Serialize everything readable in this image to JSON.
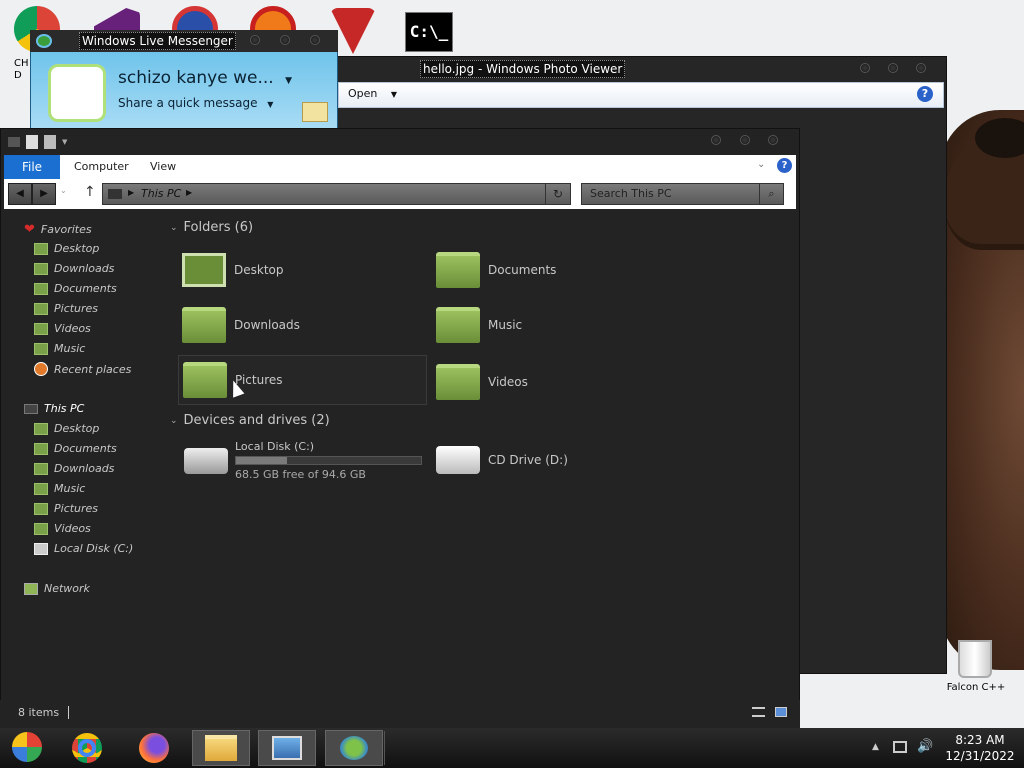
{
  "desktop": {
    "icons": [
      "chrome-icon",
      "visual-studio-icon",
      "origin-icon",
      "pdf-icon",
      "brand-icon",
      "cmd-icon"
    ],
    "cmd_label": "C:\\_",
    "partial_label": "CH\nD",
    "recycle_bin_label": "Falcon C++"
  },
  "photo_viewer": {
    "title": "hello.jpg - Windows Photo Viewer",
    "open_label": "Open",
    "help": "?"
  },
  "messenger": {
    "title": "Windows Live Messenger",
    "name": "schizo kanye we...",
    "message_placeholder": "Share a quick message"
  },
  "explorer": {
    "ribbon": {
      "file": "File",
      "computer": "Computer",
      "view": "View"
    },
    "address": "This PC",
    "search_placeholder": "Search This PC",
    "sidebar": {
      "favorites": {
        "label": "Favorites",
        "items": [
          "Desktop",
          "Downloads",
          "Documents",
          "Pictures",
          "Videos",
          "Music",
          "Recent places"
        ]
      },
      "this_pc": {
        "label": "This PC",
        "items": [
          "Desktop",
          "Documents",
          "Downloads",
          "Music",
          "Pictures",
          "Videos",
          "Local Disk (C:)"
        ]
      },
      "network": "Network"
    },
    "folders_header": "Folders (6)",
    "folders": [
      "Desktop",
      "Documents",
      "Downloads",
      "Music",
      "Pictures",
      "Videos"
    ],
    "drives_header": "Devices and drives (2)",
    "drives": [
      {
        "name": "Local Disk (C:)",
        "free": "68.5 GB free of 94.6 GB",
        "used_fraction": 0.276
      },
      {
        "name": "CD Drive (D:)"
      }
    ],
    "status": "8 items"
  },
  "taskbar": {
    "apps": [
      "start-orb",
      "chrome",
      "firefox",
      "file-explorer",
      "photo-viewer",
      "messenger"
    ],
    "time": "8:23 AM",
    "date": "12/31/2022"
  },
  "colors": {
    "accent": "#1a6fd1",
    "folder": "#8fb556",
    "window": "#232323"
  }
}
